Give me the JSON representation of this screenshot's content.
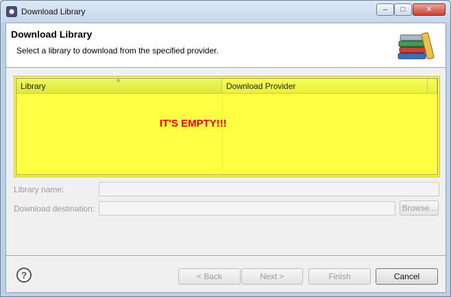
{
  "window": {
    "title": "Download Library",
    "minimize_glyph": "–",
    "maximize_glyph": "□",
    "close_glyph": "✕"
  },
  "header": {
    "title": "Download Library",
    "subtitle": "Select a library to download from the specified provider.",
    "icon": "books-icon"
  },
  "table": {
    "columns": [
      "Library",
      "Download Provider"
    ],
    "sort_indicator": "˄",
    "rows": [],
    "annotation": "IT'S EMPTY!!!",
    "highlight_color": "#ffff44"
  },
  "form": {
    "library_name_label": "Library name:",
    "library_name_value": "",
    "download_destination_label": "Download destination:",
    "download_destination_value": "",
    "browse_label": "Browse..."
  },
  "footer": {
    "help_glyph": "?",
    "back_label": "< Back",
    "next_label": "Next >",
    "finish_label": "Finish",
    "cancel_label": "Cancel"
  },
  "colors": {
    "annotation_text": "#e00000"
  }
}
